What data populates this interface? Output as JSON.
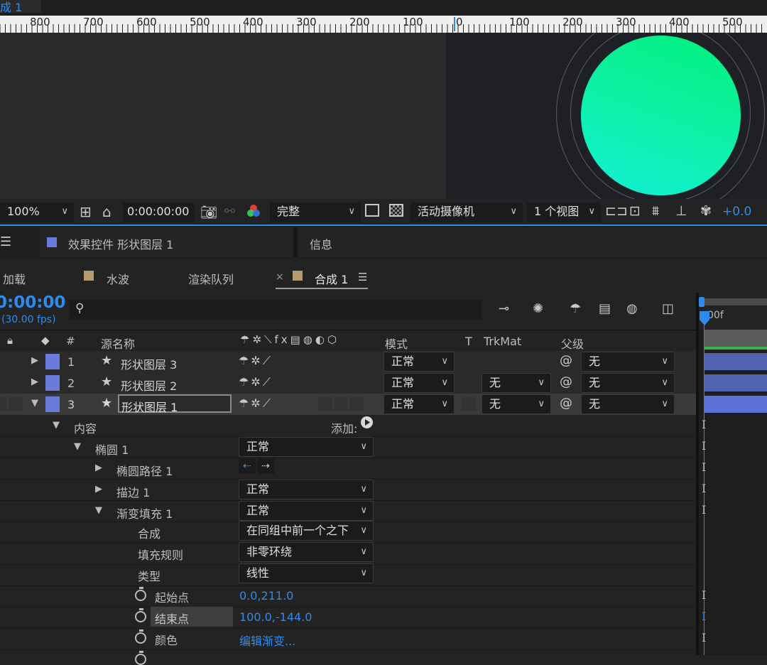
{
  "comp_tab_top": "成 1",
  "ruler": {
    "left_labels": [
      "800",
      "700",
      "600",
      "500",
      "400",
      "300",
      "200",
      "100",
      "0"
    ],
    "right_labels": [
      "100",
      "200",
      "300",
      "400",
      "500"
    ]
  },
  "viewer_toolbar": {
    "zoom": "100%",
    "timecode": "0:00:00:00",
    "resolution": "完整",
    "camera": "活动摄像机",
    "views": "1 个视图",
    "exposure": "+0.0"
  },
  "panel_tabs": {
    "effect_controls": "效果控件 形状图层 1",
    "info": "信息"
  },
  "project_tabs": {
    "load": "加载",
    "water": "水波",
    "render_queue": "渲染队列",
    "comp": "合成 1"
  },
  "timeline": {
    "time": "0:00:00",
    "fps": "(30.00 fps)",
    "ruler_start": "00f",
    "headers": {
      "num": "#",
      "source_name": "源名称",
      "mode": "模式",
      "t": "T",
      "trkmat": "TrkMat",
      "parent": "父级"
    },
    "layers": [
      {
        "num": "1",
        "name": "形状图层 3",
        "mode": "正常",
        "trkmat": "",
        "parent": "无"
      },
      {
        "num": "2",
        "name": "形状图层 2",
        "mode": "正常",
        "trkmat": "无",
        "parent": "无"
      },
      {
        "num": "3",
        "name": "形状图层 1",
        "mode": "正常",
        "trkmat": "无",
        "parent": "无"
      }
    ],
    "props": {
      "content": "内容",
      "add": "添加:",
      "ellipse": "椭圆 1",
      "ellipse_mode": "正常",
      "ellipse_path": "椭圆路径 1",
      "stroke": "描边 1",
      "stroke_mode": "正常",
      "gradient_fill": "渐变填充 1",
      "gradient_mode": "正常",
      "composite_label": "合成",
      "composite_value": "在同组中前一个之下",
      "fill_rule_label": "填充规则",
      "fill_rule_value": "非零环绕",
      "type_label": "类型",
      "type_value": "线性",
      "start_label": "起始点",
      "start_value": "0.0,211.0",
      "end_label": "结束点",
      "end_value": "100.0,-144.0",
      "color_label": "颜色",
      "color_value": "编辑渐变..."
    }
  },
  "colors": {
    "accent": "#2d8ceb",
    "label_blue": "#6a7bd9",
    "gradient_top": "#00f07a",
    "gradient_bottom": "#12f0d6"
  }
}
